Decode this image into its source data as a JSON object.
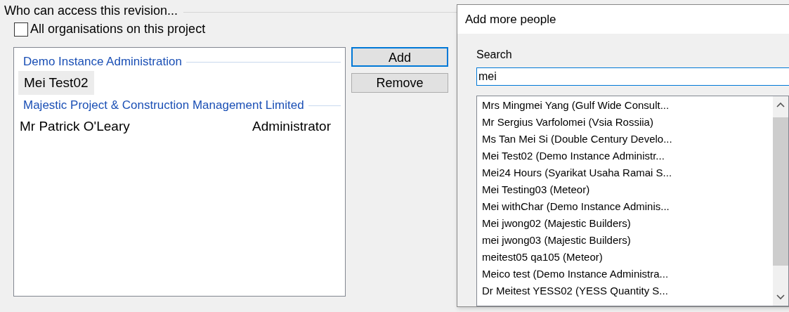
{
  "access_group": {
    "title": "Who can access this revision...",
    "all_organisations": {
      "label": "All organisations on this project",
      "checked": false
    },
    "members": [
      {
        "kind": "organisation",
        "name": "Demo Instance Administration"
      },
      {
        "kind": "person",
        "name": "Mei Test02",
        "selected": true
      },
      {
        "kind": "organisation",
        "name": "Majestic Project & Construction Management Limited"
      },
      {
        "kind": "person",
        "name": "Mr Patrick O'Leary",
        "role": "Administrator",
        "selected": false
      }
    ],
    "buttons": [
      {
        "label": "Add",
        "focused": true
      },
      {
        "label": "Remove",
        "focused": false
      }
    ]
  },
  "dialog": {
    "title": "Add more people",
    "search_label": "Search",
    "search_value": "mei",
    "results": [
      {
        "name": "Mrs Mingmei Yang (Gulf Wide Consult..."
      },
      {
        "name": "Mr Sergius Varfolomei (Vsia Rossiia)"
      },
      {
        "name": "Ms Tan Mei Si (Double Century Develo..."
      },
      {
        "name": "Mei Test02 (Demo Instance Administr..."
      },
      {
        "name": "Mei24 Hours (Syarikat Usaha Ramai S..."
      },
      {
        "name": "Mei Testing03 (Meteor)"
      },
      {
        "name": "Mei withChar (Demo Instance Adminis..."
      },
      {
        "name": "Mei jwong02 (Majestic Builders)"
      },
      {
        "name": "mei jwong03 (Majestic Builders)"
      },
      {
        "name": "meitest05 qa105 (Meteor)"
      },
      {
        "name": "Meico test (Demo Instance Administra..."
      },
      {
        "name": "Dr Meitest YESS02 (YESS Quantity S..."
      }
    ]
  }
}
